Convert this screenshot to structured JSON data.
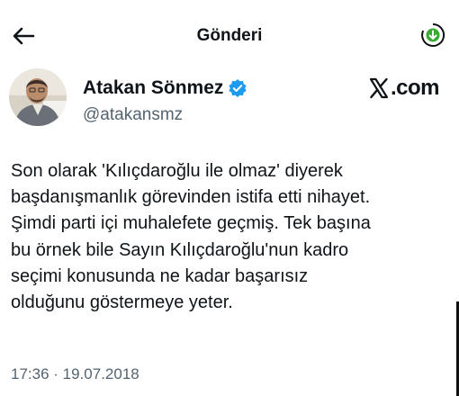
{
  "header": {
    "title": "Gönderi"
  },
  "author": {
    "name": "Atakan Sönmez",
    "handle": "@atakansmz",
    "verified": true
  },
  "brand": {
    "label": ".com"
  },
  "tweet": {
    "lines": [
      "Son olarak 'Kılıçdaroğlu ile olmaz' diyerek",
      "başdanışmanlık görevinden istifa etti nihayet.",
      "Şimdi parti içi muhalefete geçmiş. Tek başına",
      "bu örnek bile Sayın Kılıçdaroğlu'nun kadro",
      "seçimi konusunda ne kadar başarısız",
      "olduğunu göstermeye yeter."
    ],
    "timestamp": "17:36 · 19.07.2018"
  },
  "colors": {
    "text": "#0f1419",
    "secondary": "#536471",
    "verified_blue": "#1d9bf0",
    "download_green": "#3aa935"
  },
  "icons": {
    "back": "arrow-left-icon",
    "download": "download-icon",
    "verified": "verified-badge-icon",
    "brand": "x-logo-icon"
  }
}
